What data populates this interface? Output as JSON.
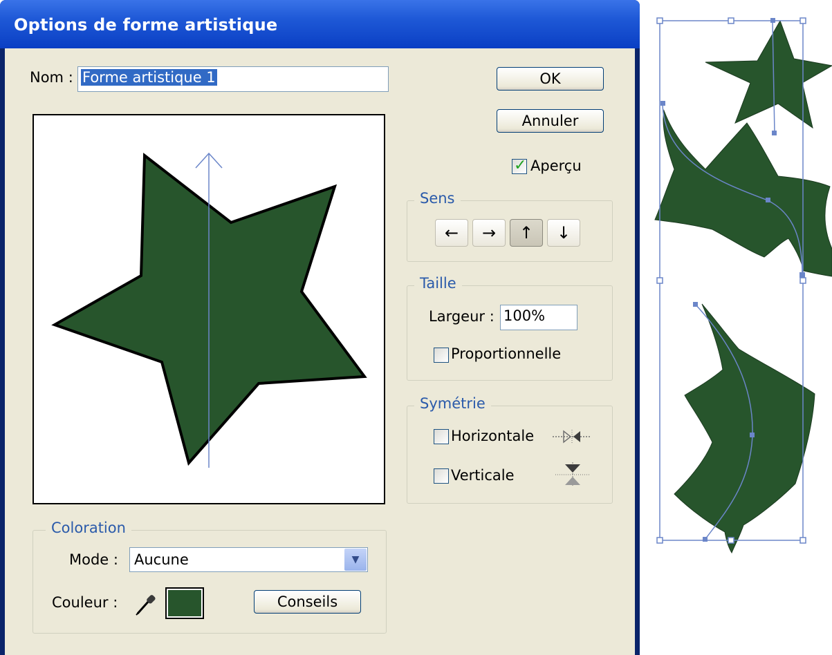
{
  "dialog": {
    "title": "Options de forme artistique",
    "name_label": "Nom :",
    "name_value": "Forme artistique 1",
    "ok_label": "OK",
    "cancel_label": "Annuler",
    "preview_label": "Aperçu",
    "preview_checked": true,
    "direction": {
      "legend": "Sens",
      "buttons": [
        {
          "glyph": "←",
          "icon": "arrow-left-icon",
          "active": false
        },
        {
          "glyph": "→",
          "icon": "arrow-right-icon",
          "active": false
        },
        {
          "glyph": "↑",
          "icon": "arrow-up-icon",
          "active": true
        },
        {
          "glyph": "↓",
          "icon": "arrow-down-icon",
          "active": false
        }
      ]
    },
    "size": {
      "legend": "Taille",
      "width_label": "Largeur :",
      "width_value": "100%",
      "proportional_label": "Proportionnelle",
      "proportional_checked": false
    },
    "flip": {
      "legend": "Symétrie",
      "horizontal_label": "Horizontale",
      "horizontal_checked": false,
      "vertical_label": "Verticale",
      "vertical_checked": false
    },
    "colorization": {
      "legend": "Coloration",
      "mode_label": "Mode :",
      "mode_value": "Aucune",
      "color_label": "Couleur :",
      "swatch_color": "#27552c",
      "tips_label": "Conseils"
    }
  },
  "colors": {
    "star_fill": "#27552c",
    "path_line": "#6b86c9",
    "title_bar": "#1e58d6",
    "dialog_face": "#ece9d8"
  }
}
